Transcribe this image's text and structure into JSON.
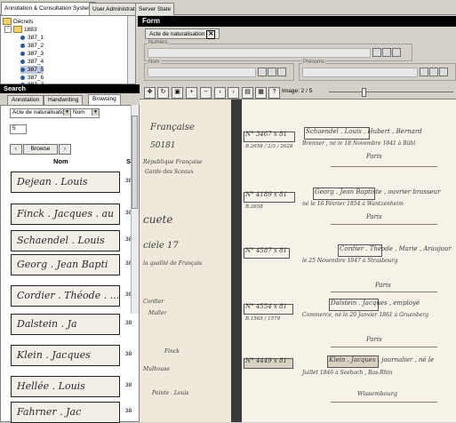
{
  "tabs": [
    "Annotation & Consultation System",
    "User Administration",
    "Server State"
  ],
  "tree": {
    "root": "Décrets",
    "year": "1883",
    "items": [
      "387_1",
      "387_2",
      "387_3",
      "387_4",
      "387_5",
      "387_6",
      "387_7"
    ],
    "selected_index": 4
  },
  "form": {
    "title": "Form",
    "tab_label": "Acte de naturalisation",
    "fields": {
      "numero": "Numéro",
      "nom": "Nom",
      "prenoms": "Prénoms"
    }
  },
  "search": {
    "title": "Search",
    "tabs": [
      "Annotation",
      "Handwriting",
      "Browsing"
    ],
    "active_tab": 2,
    "doc_type": "Acte de naturalisation",
    "field": "Nom",
    "value": "5",
    "browse_label": "Browse",
    "col_nom": "Nom",
    "col_si": "Si",
    "results": [
      {
        "sig": "Dejean . Louis",
        "code": "38"
      },
      {
        "sig": "Finck . Jacques . au",
        "code": "38"
      },
      {
        "sig": "Schaendel . Louis",
        "code": "38"
      },
      {
        "sig": "Georg . Jean Bapti",
        "code": "38"
      },
      {
        "sig": "Cordier . Théode . ...",
        "code": "38"
      },
      {
        "sig": "Dalstein . Ja",
        "code": "38"
      },
      {
        "sig": "Klein . Jacques",
        "code": "38"
      },
      {
        "sig": "Hellée . Louis",
        "code": "38"
      },
      {
        "sig": "Fahrner . Jac",
        "code": "38"
      }
    ]
  },
  "viewer": {
    "image_label": "Image: 2 / 5",
    "icons": [
      "rotate-left-icon",
      "rotate-right-icon",
      "fit-icon",
      "zoom-in-icon",
      "zoom-out-icon",
      "prev-icon",
      "next-icon",
      "print-icon",
      "save-icon",
      "help-icon"
    ]
  },
  "document": {
    "left_lines": [
      "Française",
      "50181",
      "République Française",
      "Garde des Sceaux",
      "cuete",
      "ciele 17",
      "la qualité de Français",
      "Cordier",
      "Muller",
      "Finck",
      "Mulhouse",
      "Pointe . Louis"
    ],
    "entries": [
      {
        "num": "N° 3467 x 81",
        "sub": "B.2658 / 2/3 / 2628",
        "name": "Schaendel . Louis , Hubert , Bernard",
        "line": "Brenner , né le 18 Novembre 1841 à Bühl",
        "loc": "Paris"
      },
      {
        "num": "N° 4189 x 81",
        "sub": "B.2658",
        "name": "Georg . Jean Baptiste , ouvrier brasseur",
        "line": "né le 16 Février 1854 à Wantzenheim",
        "loc": "Paris"
      },
      {
        "num": "N° 4587 x 81",
        "sub": "",
        "name": "Cordier . Théode , Marie , Araujour",
        "line": "le 25 Novembre 1847 à Strasbourg",
        "loc": "Paris"
      },
      {
        "num": "N° 4554 x 81",
        "sub": "B.1565 / 1579",
        "name": "Dalstein . Jacques , employé",
        "line": "Commerce, né le 20 Janvier 1861 à Gruenberg",
        "loc": "Paris"
      },
      {
        "num": "N° 4449 x 81",
        "sub": "",
        "name": "Klein . Jacques , journalier , né le",
        "line": "Juillet 1846 à Seebach , Bas-Rhin",
        "loc": "Wissembourg"
      }
    ]
  }
}
